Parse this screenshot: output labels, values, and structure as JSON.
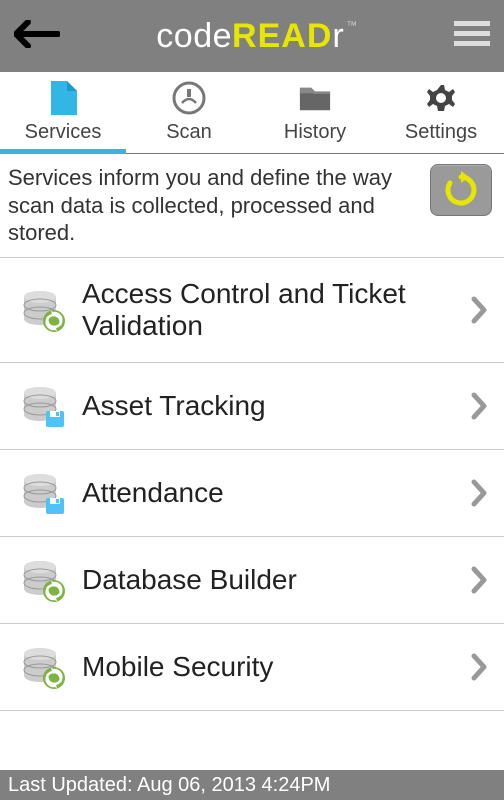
{
  "header": {
    "logo_code": "code",
    "logo_read": "READ",
    "logo_r": "r",
    "logo_tm": "™"
  },
  "tabs": [
    {
      "label": "Services",
      "icon": "document-icon",
      "active": true
    },
    {
      "label": "Scan",
      "icon": "scanner-icon",
      "active": false
    },
    {
      "label": "History",
      "icon": "folder-icon",
      "active": false
    },
    {
      "label": "Settings",
      "icon": "gear-icon",
      "active": false
    }
  ],
  "info_text": "Services inform you and define the way scan data is collected, processed and stored.",
  "services": [
    {
      "label": "Access Control and Ticket Validation",
      "icon_variant": "sync"
    },
    {
      "label": "Asset Tracking",
      "icon_variant": "save"
    },
    {
      "label": "Attendance",
      "icon_variant": "save"
    },
    {
      "label": "Database Builder",
      "icon_variant": "sync"
    },
    {
      "label": "Mobile Security",
      "icon_variant": "sync"
    }
  ],
  "footer_text": "Last Updated: Aug 06, 2013 4:24PM"
}
